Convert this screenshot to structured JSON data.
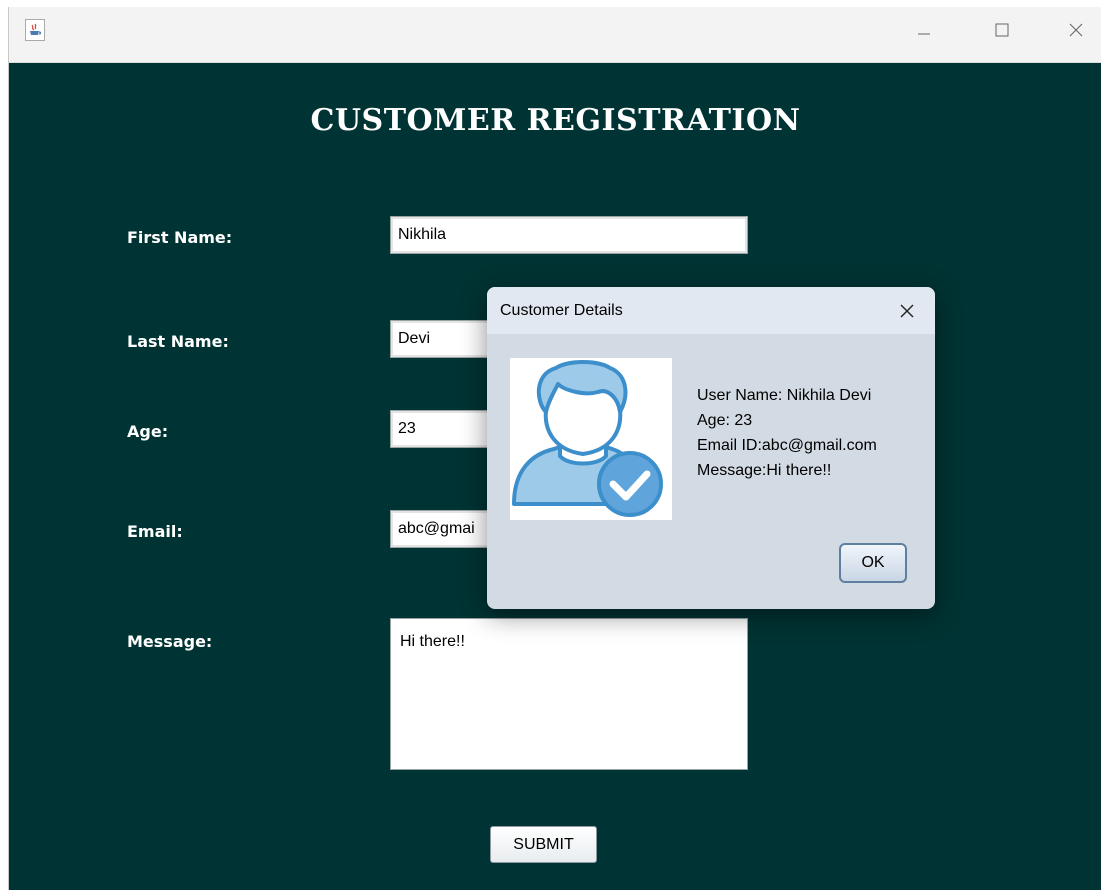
{
  "window": {
    "icon": "java-icon",
    "controls": {
      "minimize": "minimize-icon",
      "maximize": "maximize-icon",
      "close": "close-icon"
    }
  },
  "form": {
    "title": "CUSTOMER REGISTRATION",
    "fields": {
      "first_name": {
        "label": "First Name:",
        "value": "Nikhila"
      },
      "last_name": {
        "label": "Last Name:",
        "value": "Devi"
      },
      "age": {
        "label": "Age:",
        "value": "23"
      },
      "email": {
        "label": "Email:",
        "value": "abc@gmai"
      },
      "message": {
        "label": "Message:",
        "value": "Hi there!!"
      }
    },
    "submit_label": "SUBMIT"
  },
  "dialog": {
    "title": "Customer Details",
    "close_icon": "close-icon",
    "avatar_icon": "user-verified-icon",
    "lines": [
      "User Name: Nikhila Devi",
      "Age: 23",
      "Email ID:abc@gmail.com",
      "Message:Hi there!!"
    ],
    "ok_label": "OK"
  },
  "colors": {
    "background": "#003333",
    "dialog": "#d2dae3",
    "accent": "#5b9bd5"
  }
}
